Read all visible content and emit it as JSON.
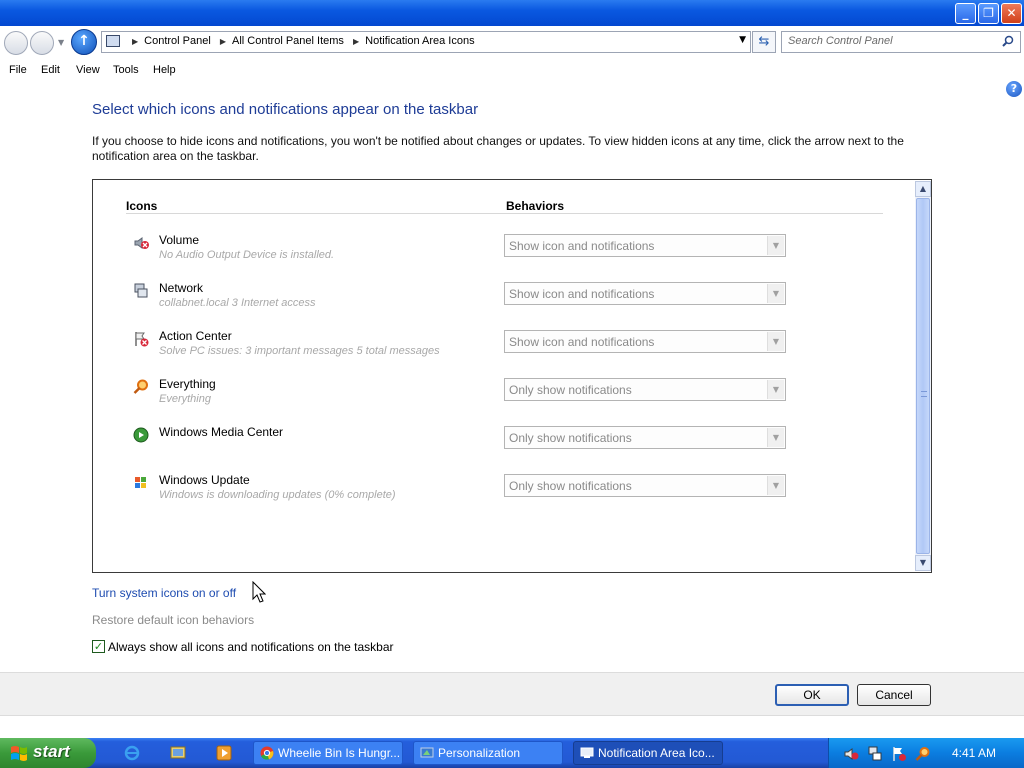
{
  "address": {
    "crumbs": [
      "Control Panel",
      "All Control Panel Items",
      "Notification Area Icons"
    ]
  },
  "search": {
    "placeholder": "Search Control Panel"
  },
  "menu": {
    "file": "File",
    "edit": "Edit",
    "view": "View",
    "tools": "Tools",
    "help": "Help"
  },
  "main": {
    "title": "Select which icons and notifications appear on the taskbar",
    "description": "If you choose to hide icons and notifications, you won't be notified about changes or updates. To view hidden icons at any time, click the arrow next to the notification area on the taskbar.",
    "columns": {
      "icons": "Icons",
      "behaviors": "Behaviors"
    },
    "items": [
      {
        "name": "Volume",
        "sub": "No Audio Output Device is installed.",
        "behavior": "Show icon and notifications",
        "icon": "volume-muted-icon"
      },
      {
        "name": "Network",
        "sub": "collabnet.local  3 Internet access",
        "behavior": "Show icon and notifications",
        "icon": "network-icon"
      },
      {
        "name": "Action Center",
        "sub": "Solve PC issues: 3 important messages  5 total messages",
        "behavior": "Show icon and notifications",
        "icon": "action-center-icon"
      },
      {
        "name": "Everything",
        "sub": "Everything",
        "behavior": "Only show notifications",
        "icon": "magnifier-icon"
      },
      {
        "name": "Windows Media Center",
        "sub": "",
        "behavior": "Only show notifications",
        "icon": "media-center-icon"
      },
      {
        "name": "Windows Update",
        "sub": "Windows is downloading updates (0% complete)",
        "behavior": "Only show notifications",
        "icon": "windows-update-icon"
      }
    ],
    "link_system_icons": "Turn system icons on or off",
    "link_restore": "Restore default icon behaviors",
    "checkbox_label": "Always show all icons and notifications on the taskbar",
    "checkbox_checked": true
  },
  "buttons": {
    "ok": "OK",
    "cancel": "Cancel"
  },
  "taskbar": {
    "start": "start",
    "tasks": [
      "Wheelie Bin Is Hungr...",
      "Personalization",
      "Notification Area Ico..."
    ],
    "clock": "4:41 AM"
  },
  "colors": {
    "title_blue": "#1e3c96",
    "link_blue": "#1e4cb0",
    "taskbar_blue": "#245edc",
    "start_green": "#3a9a3a"
  }
}
